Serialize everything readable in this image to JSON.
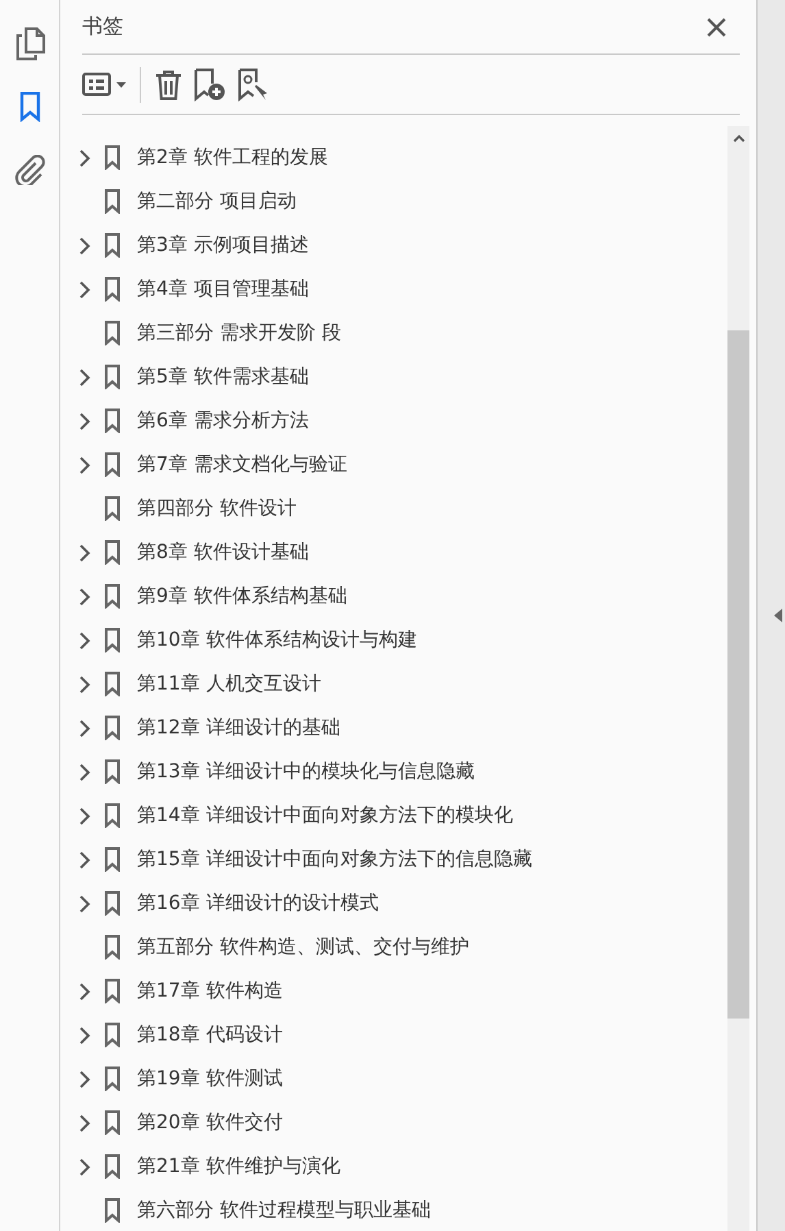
{
  "rail": [
    {
      "kind": "pages",
      "selected": false
    },
    {
      "kind": "bookmarks",
      "selected": true
    },
    {
      "kind": "attachments",
      "selected": false
    }
  ],
  "panel": {
    "title": "书签"
  },
  "bookmarks": [
    {
      "label": "第2章 软件工程的发展",
      "expandable": true
    },
    {
      "label": "第二部分 项目启动",
      "expandable": false
    },
    {
      "label": "第3章 示例项目描述",
      "expandable": true
    },
    {
      "label": "第4章 项目管理基础",
      "expandable": true
    },
    {
      "label": "第三部分 需求开发阶 段",
      "expandable": false
    },
    {
      "label": "第5章 软件需求基础",
      "expandable": true
    },
    {
      "label": "第6章 需求分析方法",
      "expandable": true
    },
    {
      "label": "第7章 需求文档化与验证",
      "expandable": true
    },
    {
      "label": "第四部分 软件设计",
      "expandable": false
    },
    {
      "label": "第8章 软件设计基础",
      "expandable": true
    },
    {
      "label": "第9章 软件体系结构基础",
      "expandable": true
    },
    {
      "label": "第10章 软件体系结构设计与构建",
      "expandable": true
    },
    {
      "label": "第11章 人机交互设计",
      "expandable": true
    },
    {
      "label": "第12章 详细设计的基础",
      "expandable": true
    },
    {
      "label": "第13章 详细设计中的模块化与信息隐藏",
      "expandable": true
    },
    {
      "label": "第14章 详细设计中面向对象方法下的模块化",
      "expandable": true
    },
    {
      "label": "第15章 详细设计中面向对象方法下的信息隐藏",
      "expandable": true
    },
    {
      "label": "第16章 详细设计的设计模式",
      "expandable": true
    },
    {
      "label": "第五部分 软件构造、测试、交付与维护",
      "expandable": false
    },
    {
      "label": "第17章 软件构造",
      "expandable": true
    },
    {
      "label": "第18章 代码设计",
      "expandable": true
    },
    {
      "label": "第19章 软件测试",
      "expandable": true
    },
    {
      "label": "第20章 软件交付",
      "expandable": true
    },
    {
      "label": "第21章 软件维护与演化",
      "expandable": true
    },
    {
      "label": "第六部分 软件过程模型与职业基础",
      "expandable": false
    }
  ]
}
